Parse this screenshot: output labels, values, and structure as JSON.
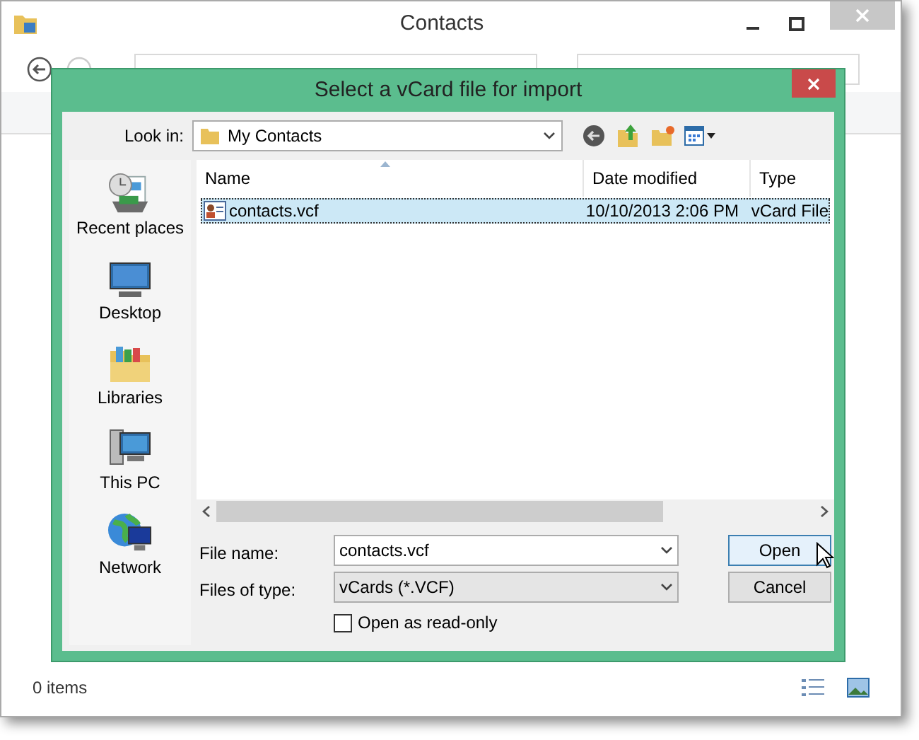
{
  "window": {
    "title": "Contacts",
    "status_bar": {
      "item_count": "0 items"
    }
  },
  "dialog": {
    "title": "Select a vCard file for import",
    "look_in": {
      "label": "Look in:",
      "value": "My Contacts"
    },
    "places": [
      {
        "label": "Recent places",
        "kind": "recent"
      },
      {
        "label": "Desktop",
        "kind": "desktop"
      },
      {
        "label": "Libraries",
        "kind": "libraries"
      },
      {
        "label": "This PC",
        "kind": "pc"
      },
      {
        "label": "Network",
        "kind": "network"
      }
    ],
    "columns": [
      {
        "label": "Name",
        "sorted": true
      },
      {
        "label": "Date modified",
        "sorted": false
      },
      {
        "label": "Type",
        "sorted": false
      }
    ],
    "files": [
      {
        "name": "contacts.vcf",
        "date_modified": "10/10/2013 2:06 PM",
        "type": "vCard File",
        "selected": true
      }
    ],
    "file_name": {
      "label": "File name:",
      "value": "contacts.vcf"
    },
    "file_type": {
      "label": "Files of type:",
      "value": "vCards (*.VCF)"
    },
    "read_only": {
      "label": "Open as read-only",
      "checked": false
    },
    "buttons": [
      {
        "label": "Open",
        "focused": true
      },
      {
        "label": "Cancel",
        "focused": false
      }
    ]
  }
}
